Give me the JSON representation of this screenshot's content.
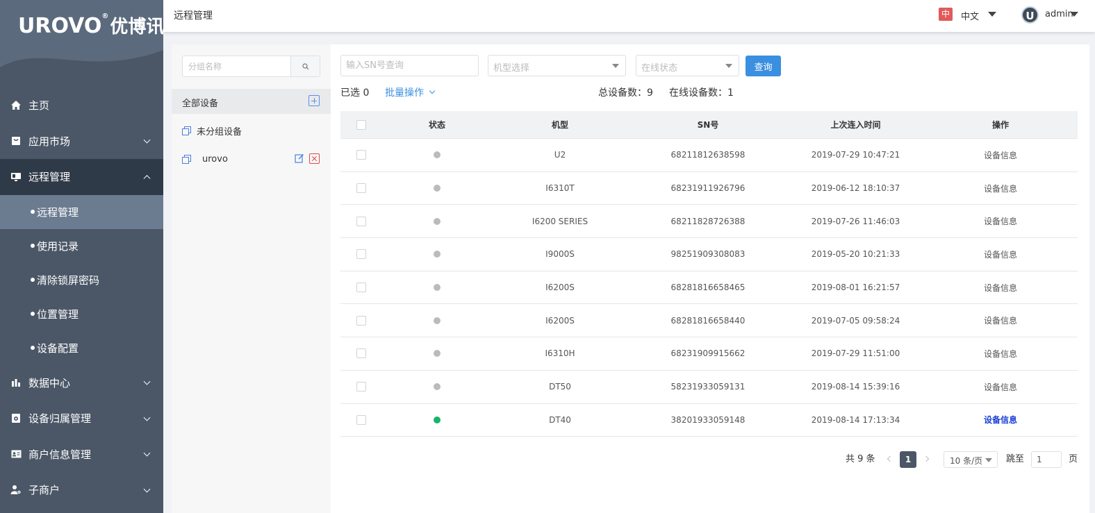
{
  "brand": {
    "logo_latin": "UROVO",
    "logo_cn": "优博讯"
  },
  "header": {
    "title": "远程管理",
    "lang_badge": "中",
    "lang": "中文",
    "avatar_letter": "U",
    "user": "admin"
  },
  "sidebar": {
    "items": [
      {
        "label": "主页",
        "icon": "home-icon",
        "has_children": false
      },
      {
        "label": "应用市场",
        "icon": "app-store-icon",
        "has_children": true
      },
      {
        "label": "远程管理",
        "icon": "remote-icon",
        "has_children": true,
        "open": true,
        "children": [
          "远程管理",
          "使用记录",
          "清除锁屏密码",
          "位置管理",
          "设备配置"
        ],
        "active_child": 0
      },
      {
        "label": "数据中心",
        "icon": "chart-icon",
        "has_children": true
      },
      {
        "label": "设备归属管理",
        "icon": "device-icon",
        "has_children": true
      },
      {
        "label": "商户信息管理",
        "icon": "id-card-icon",
        "has_children": true
      },
      {
        "label": "子商户",
        "icon": "user-settings-icon",
        "has_children": true
      }
    ]
  },
  "groups": {
    "search_placeholder": "分组名称",
    "all_label": "全部设备",
    "ungrouped_label": "未分组设备",
    "custom_group": "urovo"
  },
  "filters": {
    "sn_placeholder": "输入SN号查询",
    "model_placeholder": "机型选择",
    "status_placeholder": "在线状态",
    "query_label": "查询"
  },
  "summary": {
    "selected": "已选 0",
    "batch_label": "批量操作",
    "total": "总设备数：9",
    "online": "在线设备数：1"
  },
  "table": {
    "columns": [
      "状态",
      "机型",
      "SN号",
      "上次连入时间",
      "操作"
    ],
    "rows": [
      {
        "status": "offline",
        "model": "U2",
        "sn": "68211812638598",
        "last": "2019-07-29 10:47:21",
        "action": "设备信息"
      },
      {
        "status": "offline",
        "model": "I6310T",
        "sn": "68231911926796",
        "last": "2019-06-12 18:10:37",
        "action": "设备信息"
      },
      {
        "status": "offline",
        "model": "I6200 SERIES",
        "sn": "68211828726388",
        "last": "2019-07-26 11:46:03",
        "action": "设备信息"
      },
      {
        "status": "offline",
        "model": "I9000S",
        "sn": "98251909308083",
        "last": "2019-05-20 10:21:33",
        "action": "设备信息"
      },
      {
        "status": "offline",
        "model": "I6200S",
        "sn": "68281816658465",
        "last": "2019-08-01 16:21:57",
        "action": "设备信息"
      },
      {
        "status": "offline",
        "model": "I6200S",
        "sn": "68281816658440",
        "last": "2019-07-05 09:58:24",
        "action": "设备信息"
      },
      {
        "status": "offline",
        "model": "I6310H",
        "sn": "68231909915662",
        "last": "2019-07-29 11:51:00",
        "action": "设备信息"
      },
      {
        "status": "offline",
        "model": "DT50",
        "sn": "58231933059131",
        "last": "2019-08-14 15:39:16",
        "action": "设备信息"
      },
      {
        "status": "online",
        "model": "DT40",
        "sn": "38201933059148",
        "last": "2019-08-14 17:13:34",
        "action": "设备信息"
      }
    ]
  },
  "pagination": {
    "total_text": "共 9 条",
    "current_page": "1",
    "page_size": "10 条/页",
    "goto_label": "跳至",
    "goto_value": "1",
    "page_suffix": "页"
  },
  "colors": {
    "sidebar": "#4b5767",
    "primary": "#3b8fe0",
    "online": "#17b36b",
    "offline": "#bbbbbb",
    "badge": "#e15a5a"
  }
}
